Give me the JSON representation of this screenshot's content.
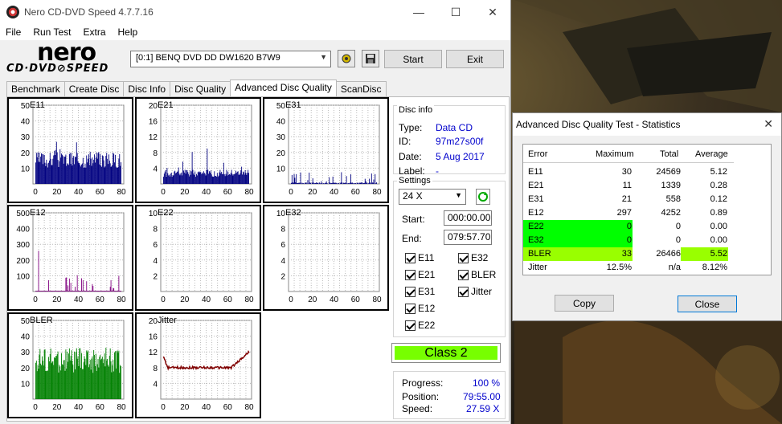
{
  "main_window": {
    "title": "Nero CD-DVD Speed 4.7.7.16",
    "controls": {
      "minimize": "—",
      "maximize": "☐",
      "close": "✕"
    },
    "menu": [
      "File",
      "Run Test",
      "Extra",
      "Help"
    ],
    "logo_top": "nero",
    "logo_bottom": "CD·DVD⊘SPEED",
    "drive": "[0:1]  BENQ DVD DD DW1620 B7W9",
    "start_label": "Start",
    "exit_label": "Exit",
    "tabs": [
      "Benchmark",
      "Create Disc",
      "Disc Info",
      "Disc Quality",
      "Advanced Disc Quality",
      "ScanDisc"
    ],
    "active_tab": "Advanced Disc Quality",
    "icons": {
      "drive_settings": "drive-gear-icon",
      "save": "floppy-save-icon",
      "refresh": "refresh-icon"
    }
  },
  "graphs": [
    {
      "label": "E11",
      "yticks": [
        "50",
        "40",
        "30",
        "20",
        "10"
      ],
      "xticks": [
        "0",
        "20",
        "40",
        "60",
        "80"
      ],
      "color": "#000080",
      "kind": "bars",
      "level": 0.34
    },
    {
      "label": "E21",
      "yticks": [
        "20",
        "16",
        "12",
        "8",
        "4"
      ],
      "xticks": [
        "0",
        "20",
        "40",
        "60",
        "80"
      ],
      "color": "#000080",
      "kind": "bars",
      "level": 0.15
    },
    {
      "label": "E31",
      "yticks": [
        "50",
        "40",
        "30",
        "20",
        "10"
      ],
      "xticks": [
        "0",
        "20",
        "40",
        "60",
        "80"
      ],
      "color": "#000080",
      "kind": "sparse",
      "level": 0.06
    },
    {
      "label": "E12",
      "yticks": [
        "500",
        "400",
        "300",
        "200",
        "100"
      ],
      "xticks": [
        "0",
        "20",
        "40",
        "60",
        "80"
      ],
      "color": "#800080",
      "kind": "spikes",
      "level": 0.03
    },
    {
      "label": "E22",
      "yticks": [
        "10",
        "8",
        "6",
        "4",
        "2"
      ],
      "xticks": [
        "0",
        "20",
        "40",
        "60",
        "80"
      ],
      "color": "#000080",
      "kind": "empty",
      "level": 0
    },
    {
      "label": "E32",
      "yticks": [
        "10",
        "8",
        "6",
        "4",
        "2"
      ],
      "xticks": [
        "0",
        "20",
        "40",
        "60",
        "80"
      ],
      "color": "#000080",
      "kind": "empty",
      "level": 0
    },
    {
      "label": "BLER",
      "yticks": [
        "50",
        "40",
        "30",
        "20",
        "10"
      ],
      "xticks": [
        "0",
        "20",
        "40",
        "60",
        "80"
      ],
      "color": "#008000",
      "kind": "bler",
      "level": 0.6
    },
    {
      "label": "Jitter",
      "yticks": [
        "20",
        "16",
        "12",
        "8",
        "4"
      ],
      "xticks": [
        "0",
        "20",
        "40",
        "60",
        "80"
      ],
      "color": "#800000",
      "kind": "jitter",
      "level": 0.4
    }
  ],
  "disc_info": {
    "title": "Disc info",
    "type_label": "Type:",
    "type": "Data CD",
    "id_label": "ID:",
    "id": "97m27s00f",
    "date_label": "Date:",
    "date": "5 Aug 2017",
    "label_label": "Label:",
    "label": "-"
  },
  "settings": {
    "title": "Settings",
    "speed": "24 X",
    "start_label": "Start:",
    "start": "000:00.00",
    "end_label": "End:",
    "end": "079:57.70",
    "checks": [
      "E11",
      "E32",
      "E21",
      "BLER",
      "E31",
      "Jitter",
      "E12",
      "E22"
    ]
  },
  "class_label": "Class 2",
  "progress": {
    "progress_label": "Progress:",
    "progress": "100 %",
    "position_label": "Position:",
    "position": "79:55.00",
    "speed_label": "Speed:",
    "speed": "27.59 X"
  },
  "stats_dialog": {
    "title": "Advanced Disc Quality Test - Statistics",
    "close_glyph": "✕",
    "headers": [
      "Error",
      "Maximum",
      "Total",
      "Average"
    ],
    "rows": [
      {
        "name": "E11",
        "max": "30",
        "total": "24569",
        "avg": "5.12",
        "hl": ""
      },
      {
        "name": "E21",
        "max": "11",
        "total": "1339",
        "avg": "0.28",
        "hl": ""
      },
      {
        "name": "E31",
        "max": "21",
        "total": "558",
        "avg": "0.12",
        "hl": ""
      },
      {
        "name": "E12",
        "max": "297",
        "total": "4252",
        "avg": "0.89",
        "hl": ""
      },
      {
        "name": "E22",
        "max": "0",
        "total": "0",
        "avg": "0.00",
        "hl": "#00ff00"
      },
      {
        "name": "E32",
        "max": "0",
        "total": "0",
        "avg": "0.00",
        "hl": "#00ff00"
      },
      {
        "name": "BLER",
        "max": "33",
        "total": "26466",
        "avg": "5.52",
        "hl": "#99ff00"
      },
      {
        "name": "Jitter",
        "max": "12.5%",
        "total": "n/a",
        "avg": "8.12%",
        "hl": ""
      }
    ],
    "copy_label": "Copy",
    "close_label": "Close"
  }
}
